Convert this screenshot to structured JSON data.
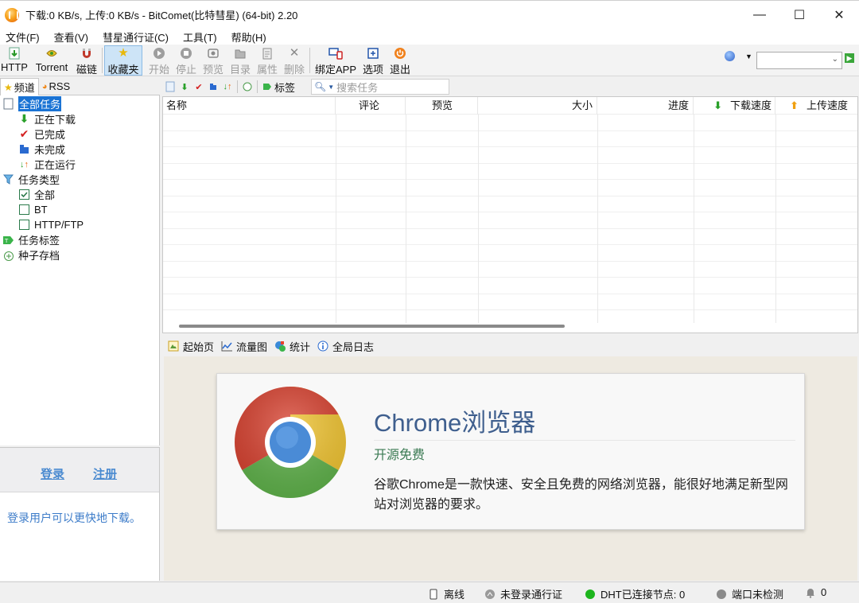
{
  "window": {
    "title": "下载:0 KB/s, 上传:0 KB/s - BitComet(比特彗星) (64-bit) 2.20",
    "controls": {
      "minimize": "—",
      "maximize": "☐",
      "close": "✕"
    }
  },
  "menu": [
    "文件(F)",
    "查看(V)",
    "彗星通行证(C)",
    "工具(T)",
    "帮助(H)"
  ],
  "toolbar": {
    "http": "HTTP",
    "torrent": "Torrent",
    "magnet": "磁链",
    "favorites": "收藏夹",
    "start": "开始",
    "stop": "停止",
    "preview": "预览",
    "directory": "目录",
    "properties": "属性",
    "delete": "删除",
    "bind_app": "绑定APP",
    "options": "选项",
    "exit": "退出",
    "go": "▶"
  },
  "left_tabs": {
    "channel": "频道",
    "rss": "RSS"
  },
  "tree": {
    "all_tasks": "全部任务",
    "downloading": "正在下载",
    "completed": "已完成",
    "incomplete": "未完成",
    "running": "正在运行",
    "task_types": "任务类型",
    "all": "全部",
    "bt": "BT",
    "http_ftp": "HTTP/FTP",
    "task_tags": "任务标签",
    "torrent_archive": "种子存档"
  },
  "login": {
    "login": "登录",
    "register": "注册",
    "message": "登录用户可以更快地下载。"
  },
  "task_toolbar": {
    "tags": "标签",
    "search_placeholder": "搜索任务"
  },
  "table": {
    "columns": [
      "名称",
      "评论",
      "预览",
      "大小",
      "进度",
      "下载速度",
      "上传速度"
    ],
    "rows": []
  },
  "bottom_tabs": [
    "起始页",
    "流量图",
    "统计",
    "全局日志"
  ],
  "card": {
    "title": "Chrome浏览器",
    "subtitle": "开源免费",
    "description": "谷歌Chrome是一款快速、安全且免费的网络浏览器，能很好地满足新型网站对浏览器的要求。"
  },
  "status": {
    "offline": "离线",
    "passport": "未登录通行证",
    "dht": "DHT已连接节点:  0",
    "port": "端口未检测",
    "count": "0"
  },
  "colors": {
    "selection": "#1a73d4",
    "link": "#4a8ad0",
    "card_title": "#3f5f8e",
    "card_subtitle": "#3a7a52",
    "dht_ok": "#1db51d"
  }
}
